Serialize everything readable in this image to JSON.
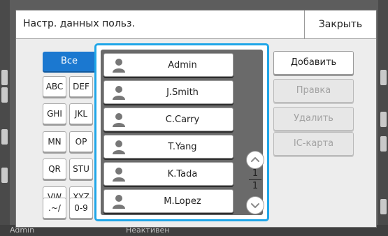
{
  "background": {
    "status_left": "Admin",
    "status_center": "Неактивен"
  },
  "dialog": {
    "title": "Настр. данных польз.",
    "close_label": "Закрыть"
  },
  "filters": {
    "all_label": "Все",
    "groups": [
      {
        "left": "ABC",
        "right": "DEF"
      },
      {
        "left": "GHI",
        "right": "JKL"
      },
      {
        "left": "MN",
        "right": "OP"
      },
      {
        "left": "QR",
        "right": "STU"
      },
      {
        "left": "VW",
        "right": "XYZ"
      },
      {
        "left": ".~/",
        "right": "0-9"
      }
    ]
  },
  "users": [
    "Admin",
    "J.Smith",
    "C.Carry",
    "T.Yang",
    "K.Tada",
    "M.Lopez"
  ],
  "pagination": {
    "current": "1",
    "total": "1"
  },
  "actions": {
    "add": "Добавить",
    "edit": "Правка",
    "delete": "Удалить",
    "ic_card": "IC-карта"
  },
  "colors": {
    "accent": "#1b78d0",
    "panel_border": "#1fa6e8"
  },
  "icons": [
    "user-icon",
    "chevron-up-icon",
    "chevron-down-icon"
  ]
}
